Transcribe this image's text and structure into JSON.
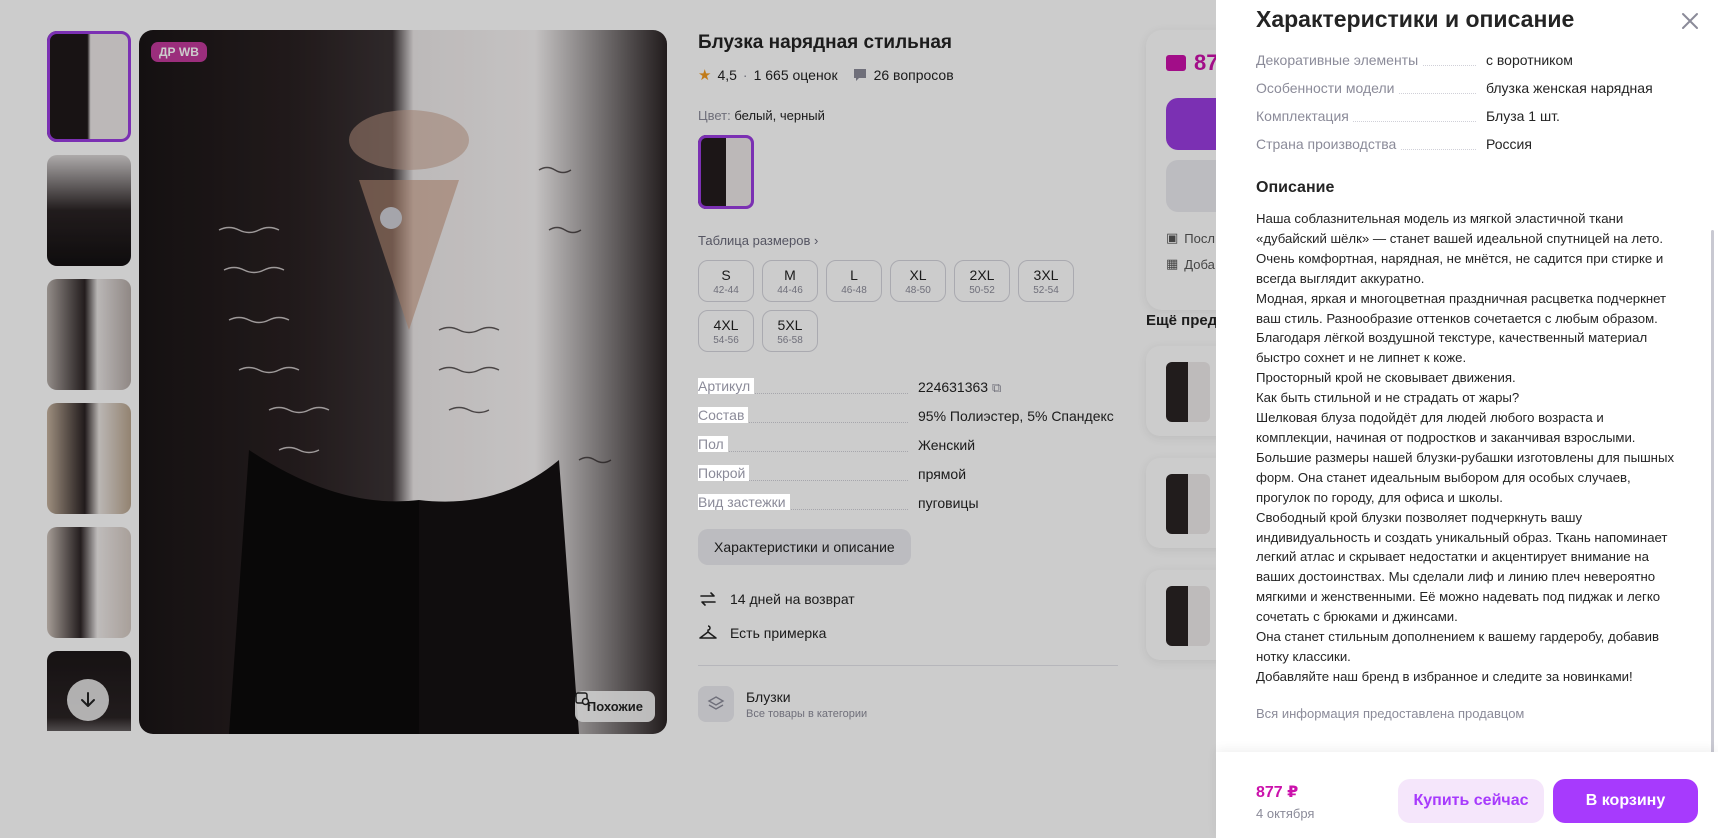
{
  "product": {
    "badge": "ДР WB",
    "similar_label": "Похожие",
    "title": "Блузка нарядная стильная",
    "rating": "4,5",
    "reviews": "1 665 оценок",
    "questions": "26 вопросов",
    "color_label": "Цвет:",
    "color_value": "белый, черный",
    "size_table_label": "Таблица размеров",
    "sizes": [
      {
        "size": "S",
        "range": "42-44"
      },
      {
        "size": "M",
        "range": "44-46"
      },
      {
        "size": "L",
        "range": "46-48"
      },
      {
        "size": "XL",
        "range": "48-50"
      },
      {
        "size": "2XL",
        "range": "50-52"
      },
      {
        "size": "3XL",
        "range": "52-54"
      },
      {
        "size": "4XL",
        "range": "54-56"
      },
      {
        "size": "5XL",
        "range": "56-58"
      }
    ],
    "specs": [
      {
        "key": "Артикул",
        "value": "224631363"
      },
      {
        "key": "Состав",
        "value": "95% Полиэстер, 5% Спандекс"
      },
      {
        "key": "Пол",
        "value": "Женский"
      },
      {
        "key": "Покрой",
        "value": "прямой"
      },
      {
        "key": "Вид застежки",
        "value": "пуговицы"
      }
    ],
    "char_button": "Характеристики и описание",
    "perks": [
      "14 дней на возврат",
      "Есть примерка"
    ],
    "category_name": "Блузки",
    "category_sub": "Все товары в категории"
  },
  "buy_card": {
    "price_partial": "87",
    "row1": "Посл",
    "row2": "Доба"
  },
  "more": {
    "title": "Ещё пред"
  },
  "drawer": {
    "title": "Характеристики и описание",
    "specs": [
      {
        "key": "Декоративные элементы",
        "value": "с воротником"
      },
      {
        "key": "Особенности модели",
        "value": "блузка женская нарядная"
      },
      {
        "key": "Комплектация",
        "value": "Блуза 1 шт."
      },
      {
        "key": "Страна производства",
        "value": "Россия"
      }
    ],
    "description_heading": "Описание",
    "description": "Наша соблазнительная модель из мягкой эластичной ткани «дубайский шёлк» — станет вашей идеальной спутницей на лето. Очень комфортная, нарядная, не мнётся, не садится при стирке и всегда выглядит аккуратно.\nМодная, яркая и многоцветная праздничная расцветка подчеркнет ваш стиль. Разнообразие оттенков сочетается с любым образом. Благодаря лёгкой воздушной текстуре, качественный материал быстро сохнет и не липнет к коже.\nПросторный крой не сковывает движения.\nКак быть стильной и не страдать от жары?\nШелковая блуза подойдёт для людей любого возраста и комплекции, начиная от подростков и заканчивая взрослыми. Большие размеры нашей блузки-рубашки изготовлены для пышных форм. Она станет идеальным выбором для особых случаев, прогулок по городу, для офиса и школы.\nСвободный крой блузки позволяет подчеркнуть вашу индивидуальность и создать уникальный образ. Ткань напоминает легкий атлас и скрывает недостатки и акцентирует внимание на ваших достоинствах. Мы сделали лиф и линию плеч невероятно мягкими и женственными. Её можно надевать под пиджак и легко сочетать с брюками и джинсами.\nОна станет стильным дополнением к вашему гардеробу, добавив нотку классики.\nДобавляйте наш бренд в избранное и следите за новинками!",
    "note": "Вся информация предоставлена продавцом",
    "footer": {
      "price": "877 ₽",
      "date": "4 октября",
      "buy_now": "Купить сейчас",
      "add_to_cart": "В корзину"
    }
  },
  "colors": {
    "accent": "#a73afd",
    "price": "#cb11ab",
    "muted": "#8b8b99"
  }
}
